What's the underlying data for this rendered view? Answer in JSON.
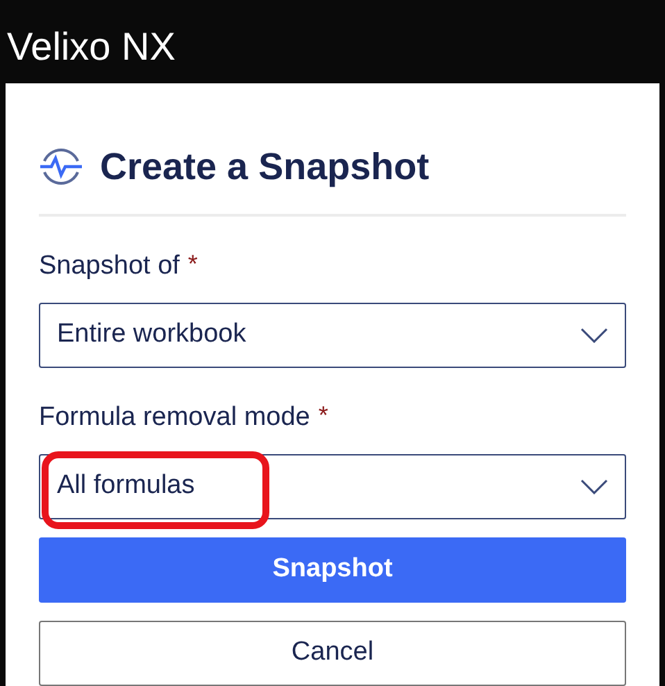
{
  "window": {
    "title": "Velixo NX"
  },
  "dialog": {
    "title": "Create a Snapshot",
    "fields": [
      {
        "label": "Snapshot of",
        "required_mark": "*",
        "value": "Entire workbook",
        "highlighted": false
      },
      {
        "label": "Formula removal mode",
        "required_mark": "*",
        "value": "All formulas",
        "highlighted": true
      }
    ],
    "buttons": [
      {
        "label": "Snapshot",
        "kind": "primary"
      },
      {
        "label": "Cancel",
        "kind": "secondary"
      }
    ]
  }
}
